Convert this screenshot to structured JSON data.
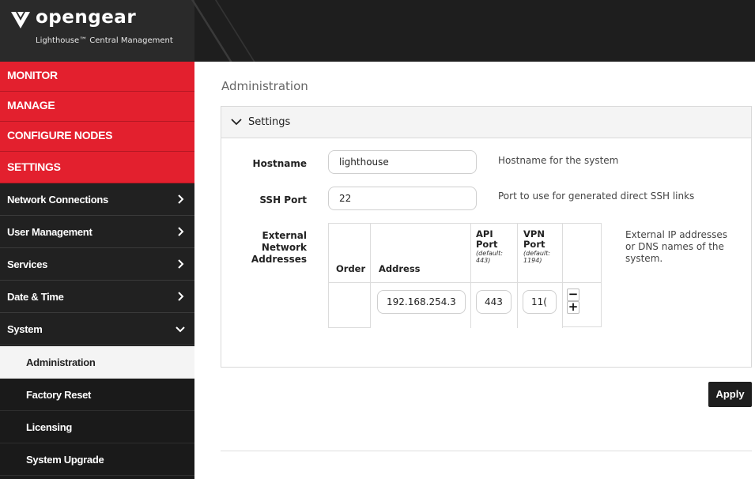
{
  "brand": {
    "name": "opengear",
    "subtitle": "Lighthouse™ Central Management"
  },
  "nav": {
    "top": [
      {
        "label": "MONITOR"
      },
      {
        "label": "MANAGE"
      },
      {
        "label": "CONFIGURE NODES"
      },
      {
        "label": "SETTINGS"
      }
    ],
    "sections": [
      {
        "label": "Network Connections",
        "expanded": false
      },
      {
        "label": "User Management",
        "expanded": false
      },
      {
        "label": "Services",
        "expanded": false
      },
      {
        "label": "Date & Time",
        "expanded": false
      },
      {
        "label": "System",
        "expanded": true
      }
    ],
    "system_items": [
      {
        "label": "Administration",
        "active": true
      },
      {
        "label": "Factory Reset",
        "active": false
      },
      {
        "label": "Licensing",
        "active": false
      },
      {
        "label": "System Upgrade",
        "active": false
      }
    ]
  },
  "page": {
    "title": "Administration"
  },
  "settings": {
    "panel_title": "Settings",
    "hostname": {
      "label": "Hostname",
      "value": "lighthouse",
      "help": "Hostname for the system"
    },
    "ssh_port": {
      "label": "SSH Port",
      "value": "22",
      "help": "Port to use for generated direct SSH links"
    },
    "external": {
      "label_line1": "External",
      "label_line2": "Network",
      "label_line3": "Addresses",
      "help_line1": "External IP addresses",
      "help_line2": "or DNS names of the",
      "help_line3": "system.",
      "columns": {
        "order": "Order",
        "address": "Address",
        "api_line1": "API",
        "api_line2": "Port",
        "api_default_line1": "(default:",
        "api_default_line2": "443)",
        "vpn_line1": "VPN",
        "vpn_line2": "Port",
        "vpn_default_line1": "(default:",
        "vpn_default_line2": "1194)"
      },
      "rows": [
        {
          "order": "",
          "address": "192.168.254.3",
          "api_port": "443",
          "vpn_port": "11("
        }
      ],
      "remove_label": "−",
      "add_label": "+"
    }
  },
  "actions": {
    "apply_label": "Apply"
  },
  "colors": {
    "accent_red": "#e3202e",
    "sidebar_dark": "#212121",
    "header_bg": "#1e1e1e"
  }
}
